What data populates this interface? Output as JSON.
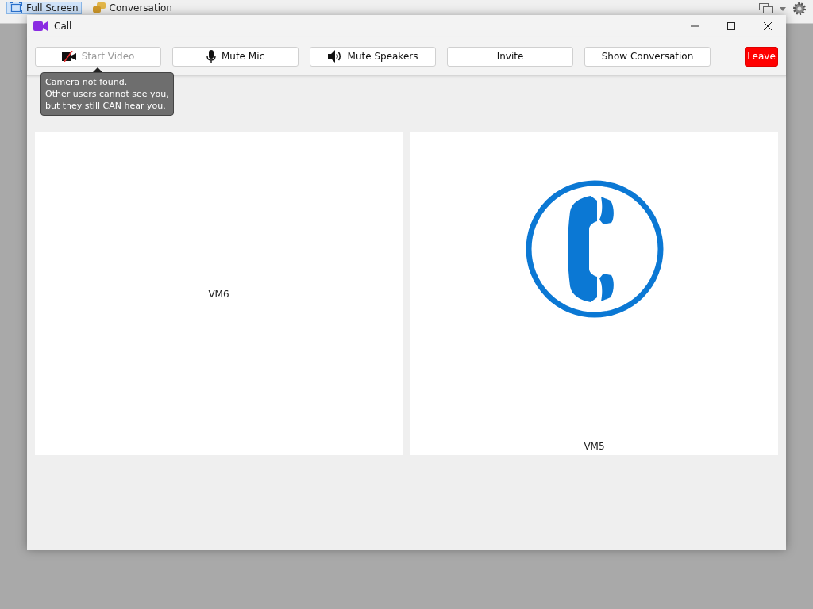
{
  "host_toolbar": {
    "items": [
      {
        "label": "Full Screen",
        "selected": true,
        "kind": "fullscreen"
      },
      {
        "label": "Conversation",
        "selected": false,
        "kind": "chat"
      }
    ]
  },
  "window": {
    "title": "Call"
  },
  "toolbar": {
    "buttons": [
      {
        "label": "Start Video",
        "kind": "camera-off",
        "disabled": true
      },
      {
        "label": "Mute Mic",
        "kind": "mic",
        "disabled": false
      },
      {
        "label": "Mute Speakers",
        "kind": "speaker",
        "disabled": false
      },
      {
        "label": "Invite",
        "kind": "plain",
        "disabled": false
      },
      {
        "label": "Show Conversation",
        "kind": "plain",
        "disabled": false
      },
      {
        "label": "Leave",
        "kind": "leave",
        "disabled": false
      }
    ]
  },
  "tooltip": {
    "text": "Camera not found.\nOther users cannot see you,\nbut they still CAN hear you."
  },
  "tiles": [
    {
      "name": "VM6",
      "kind": "blank"
    },
    {
      "name": "VM5",
      "kind": "phone"
    }
  ]
}
